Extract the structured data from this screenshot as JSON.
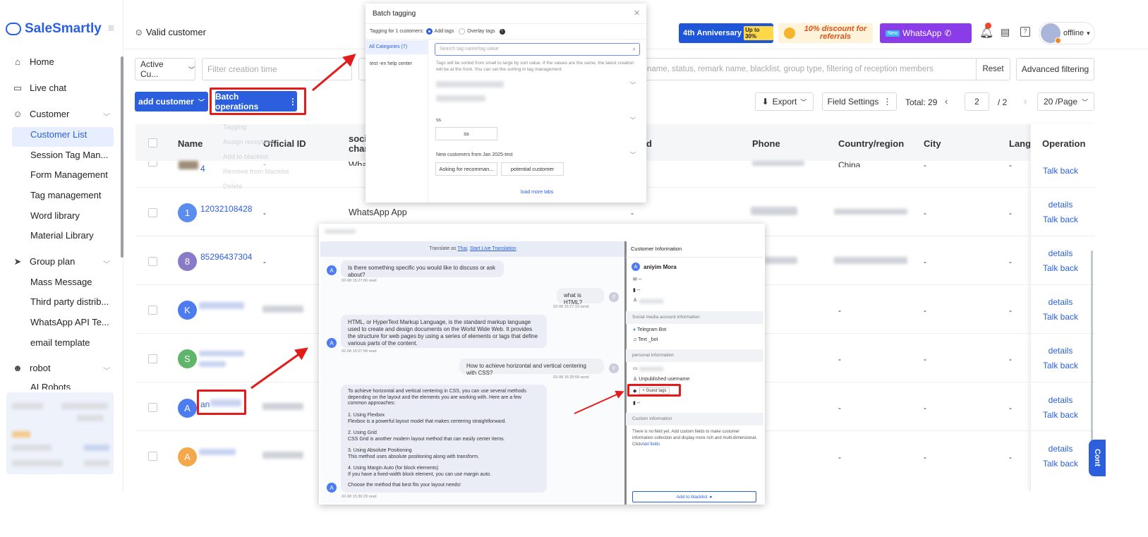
{
  "brand": {
    "name": "SaleSmartly"
  },
  "sidebar": {
    "items": [
      {
        "label": "Home"
      },
      {
        "label": "Live chat"
      },
      {
        "label": "Customer"
      },
      {
        "label": "Group plan"
      },
      {
        "label": "robot"
      }
    ],
    "customer_sub": [
      "Customer List",
      "Session Tag Man...",
      "Form Management",
      "Tag management",
      "Word library",
      "Material Library"
    ],
    "group_sub": [
      "Mass Message",
      "Third party distrib...",
      "WhatsApp API Te...",
      "email template"
    ],
    "robot_sub": [
      "AI Robots"
    ]
  },
  "header": {
    "title": "Valid customer",
    "banner1": "Anniversary",
    "banner1_num": "4th",
    "banner1_badge": "Up to 30%",
    "banner2": "10% discount for referrals",
    "banner3_badge": "New",
    "banner3": "WhatsApp",
    "status": "offline"
  },
  "filters": {
    "segment": "Active Cu...",
    "creation_placeholder": "Filter creation time",
    "help_center": "test -en help center",
    "search_placeholder": "name, status, remark name, blacklist, group type, filtering of reception members",
    "reset": "Reset",
    "advanced": "Advanced filtering"
  },
  "toolbar": {
    "add_customer": "add customer",
    "batch": "Batch operations",
    "export": "Export",
    "field_settings": "Field Settings",
    "total_label": "Total:",
    "total": "29",
    "page": "2",
    "pages": "/ 2",
    "per_page": "20 /Page"
  },
  "batch_menu": [
    "Tagging",
    "Assign reception",
    "Add to blacklist",
    "Remove from blacklist",
    "Delete"
  ],
  "table": {
    "headers": [
      "Name",
      "Official ID",
      "social chan",
      "d",
      "Phone",
      "Country/region",
      "City",
      "Langu",
      "Operation"
    ],
    "rows": [
      {
        "avatar": "",
        "name": "4",
        "official": "-",
        "channel": "Wha",
        "phone": "",
        "country": "China",
        "city": "-",
        "lang": "-",
        "ops": [
          "Talk back"
        ]
      },
      {
        "avatar": "1",
        "name": "12032108428",
        "official": "-",
        "channel": "WhatsApp App",
        "d": "-",
        "city": "-",
        "lang": "-",
        "ops": [
          "details",
          "Talk back"
        ]
      },
      {
        "avatar": "8",
        "name": "85296437304",
        "official": "-",
        "city": "-",
        "lang": "-",
        "ops": [
          "details",
          "Talk back"
        ]
      },
      {
        "avatar": "K",
        "name": "",
        "official": "",
        "city": "-",
        "lang": "-",
        "d": "-",
        "ops": [
          "details",
          "Talk back"
        ]
      },
      {
        "avatar": "S",
        "name": "",
        "city": "-",
        "lang": "-",
        "d": "-",
        "ops": [
          "details",
          "Talk back"
        ]
      },
      {
        "avatar": "A",
        "name": "an",
        "city": "-",
        "lang": "-",
        "d": "-",
        "ops": [
          "details",
          "Talk back"
        ]
      },
      {
        "avatar": "A",
        "name": "",
        "city": "-",
        "lang": "-",
        "d": "-",
        "ops": [
          "details",
          "Talk back"
        ]
      }
    ],
    "side_tab": "Cont"
  },
  "tagging": {
    "title": "Batch tagging",
    "for_label": "Tagging for 1 customers:",
    "add_tags": "Add tags",
    "overlay_tags": "Overlay tags",
    "cat_all": "All Categories (7)",
    "cat_help": "test -en help center",
    "search_placeholder": "Search tag name/tag value",
    "note": "Tags will be sorted from small to large by sort value. If the values are the same, the latest creation will be at the front. You can set the sorting in tag management",
    "group_ss": "ss",
    "tag_ss": "ss",
    "group_new": "New customers from Jan 2025-test",
    "tag1": "Asking for recomman...",
    "tag2": "potential customer",
    "load_more": "load more tabs"
  },
  "chat": {
    "translate_prefix": "Translate as",
    "translate_lang": "Thai",
    "translate_action": "Start Live Translation",
    "messages": [
      {
        "text": "Is there something specific you would like to discuss or ask about?",
        "meta": "02-08 15:27:00  read"
      },
      {
        "text": "what is HTML?",
        "meta": "02-08 15:27:19  send"
      },
      {
        "text": "HTML, or HyperText Markup Language, is the standard markup language used to create and design documents on the World Wide Web. It provides the structure for web pages by using a series of elements or tags that define various parts of the content.",
        "meta": "02-08 15:27:58  read"
      },
      {
        "text": "How to achieve horizontal and vertical centering with CSS?",
        "meta": "02-08 15:28:58  send"
      },
      {
        "text": "To achieve horizontal and vertical centering in CSS, you can use several methods depending on the layout and the elements you are working with. Here are a few common approaches:",
        "meta": ""
      },
      {
        "text": "1. Using Flexbox\nFlexbox is a powerful layout model that makes centering straightforward.",
        "meta": ""
      },
      {
        "text": "2. Using Grid\nCSS Grid is another modern layout method that can easily center items.",
        "meta": ""
      },
      {
        "text": "3. Using Absolute Positioning\nThis method uses absolute positioning along with transform.",
        "meta": ""
      },
      {
        "text": "4. Using Margin Auto (for block elements)\nIf you have a fixed-width block element, you can use margin auto.",
        "meta": ""
      },
      {
        "text": "Choose the method that best fits your layout needs!",
        "meta": "02-08 15:30:29  read"
      }
    ]
  },
  "customer_info": {
    "title": "Customer Information",
    "name": "aniyim Mora",
    "social_header": "Social media account information",
    "telegram": "Telegram Bot",
    "bot": "Text _bot",
    "personal_header": "personal information",
    "unpublished": "Unpublished username",
    "guest_tags": "+ Guest tags",
    "custom_header": "Custom information",
    "custom_note": "There is no field yet. Add custom fields to make customer information collection and display more rich and multi-dimensional. Click",
    "add_fields": "Add fields",
    "blacklist": "Add to blacklist",
    "dash": "--"
  },
  "colors": {
    "primary": "#2b5fde",
    "highlight": "#e31b1b"
  }
}
